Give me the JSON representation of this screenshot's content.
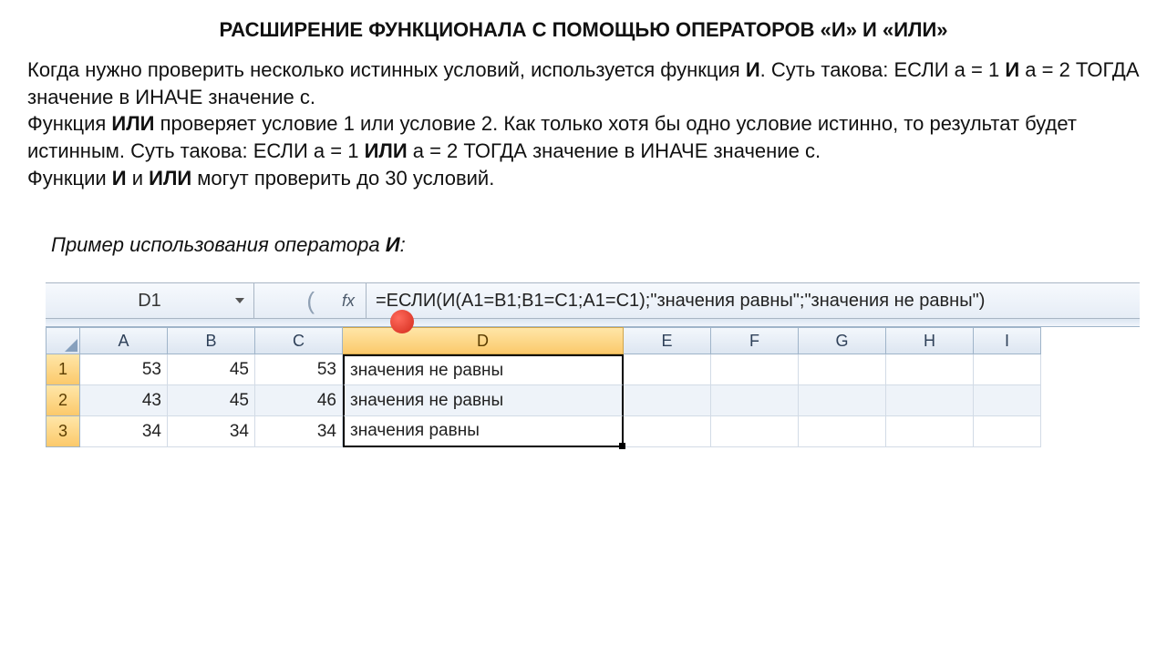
{
  "title": "РАСШИРЕНИЕ ФУНКЦИОНАЛА С ПОМОЩЬЮ ОПЕРАТОРОВ «И» И «ИЛИ»",
  "paragraph": {
    "p1a": "Когда нужно проверить несколько истинных условий, используется функция ",
    "p1b": "И",
    "p1c": ". Суть такова: ЕСЛИ а = 1 ",
    "p1d": "И",
    "p1e": " а = 2 ТОГДА значение в ИНАЧЕ значение с.",
    "p2a": "Функция ",
    "p2b": "ИЛИ",
    "p2c": " проверяет условие 1 или условие 2. Как только хотя бы одно условие истинно, то результат будет истинным. Суть такова: ЕСЛИ а = 1 ",
    "p2d": "ИЛИ",
    "p2e": " а = 2 ТОГДА значение в ИНАЧЕ значение с.",
    "p3a": "Функции ",
    "p3b": "И",
    "p3c": " и ",
    "p3d": "ИЛИ",
    "p3e": " могут проверить до 30 условий."
  },
  "example_label_pre": "Пример использования оператора ",
  "example_label_op": "И",
  "example_label_post": ":",
  "excel": {
    "name_box": "D1",
    "fx_label": "fx",
    "formula": "=ЕСЛИ(И(A1=B1;B1=C1;A1=C1);\"значения равны\";\"значения не равны\")",
    "columns": [
      "A",
      "B",
      "C",
      "D",
      "E",
      "F",
      "G",
      "H",
      "I"
    ],
    "active_col": "D",
    "rows": [
      {
        "n": "1",
        "A": "53",
        "B": "45",
        "C": "53",
        "D": "значения не равны"
      },
      {
        "n": "2",
        "A": "43",
        "B": "45",
        "C": "46",
        "D": "значения не равны"
      },
      {
        "n": "3",
        "A": "34",
        "B": "34",
        "C": "34",
        "D": "значения равны"
      }
    ]
  }
}
